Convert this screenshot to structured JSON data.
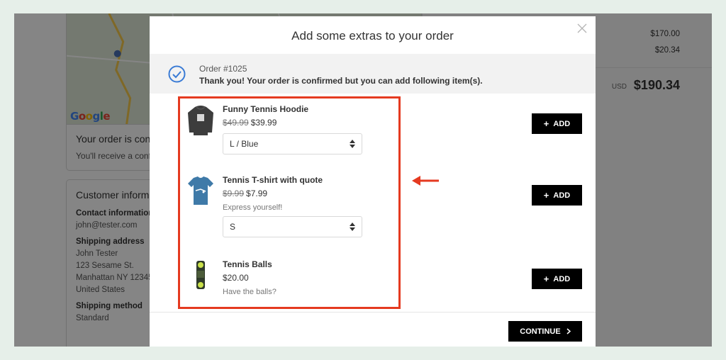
{
  "background": {
    "map_logo": "Google",
    "map_logo_letters": [
      "G",
      "o",
      "o",
      "g",
      "l",
      "e"
    ],
    "confirm_title": "Your order is con",
    "confirm_sub": "You'll receive a confi",
    "customer": {
      "title": "Customer inform",
      "contact_heading": "Contact information",
      "email": "john@tester.com",
      "shipping_heading": "Shipping address",
      "address_lines": [
        "John Tester",
        "123 Sesame St.",
        "Manhattan NY 12345",
        "United States"
      ],
      "method_heading": "Shipping method",
      "method": "Standard"
    },
    "summary": {
      "subtotal": "$170.00",
      "shipping": "$20.34",
      "total_currency": "USD",
      "total": "$190.34"
    }
  },
  "modal": {
    "title": "Add some extras to your order",
    "close_icon": "close-icon",
    "order_number": "Order #1025",
    "notice": "Thank you! Your order is confirmed but you can add following item(s).",
    "add_label": "ADD",
    "continue_label": "CONTINUE",
    "products": [
      {
        "name": "Funny Tennis Hoodie",
        "old_price": "$49.99",
        "price": "$39.99",
        "description": "",
        "variant": "L / Blue"
      },
      {
        "name": "Tennis T-shirt with quote",
        "old_price": "$9.99",
        "price": "$7.99",
        "description": "Express yourself!",
        "variant": "S"
      },
      {
        "name": "Tennis Balls",
        "old_price": "",
        "price": "$20.00",
        "description": "Have the balls?",
        "variant": ""
      }
    ]
  },
  "colors": {
    "accent_red": "#e53a20",
    "check_blue": "#3a7bd5",
    "button_black": "#000000"
  }
}
